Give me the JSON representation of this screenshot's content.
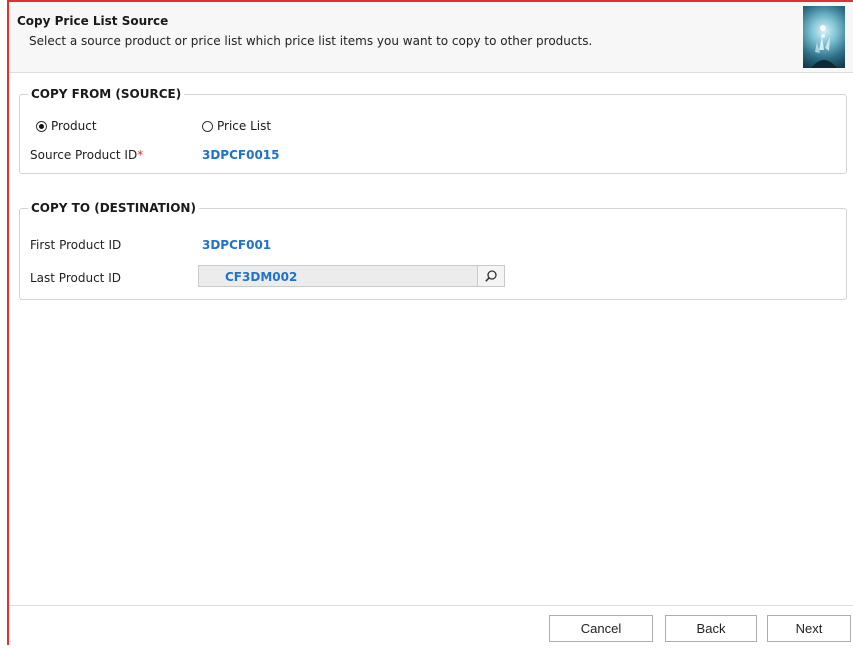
{
  "header": {
    "title": "Copy Price List Source",
    "subtitle": "Select a source product or price list which price list items you want to copy to other products."
  },
  "copy_from": {
    "title": "COPY FROM (SOURCE)",
    "options": [
      {
        "label": "Product",
        "selected": true
      },
      {
        "label": "Price List",
        "selected": false
      }
    ],
    "source_product_label": "Source Product ID",
    "required_mark": "*",
    "source_product_value": "3DPCF0015"
  },
  "copy_to": {
    "title": "COPY TO (DESTINATION)",
    "first_product_label": "First Product ID",
    "first_product_value": "3DPCF001",
    "last_product_label": "Last Product ID",
    "last_product_value": "CF3DM002"
  },
  "footer": {
    "cancel_label": "Cancel",
    "back_label": "Back",
    "next_label": "Next"
  },
  "icons": {
    "header_image": "wizard-graphic-icon",
    "lookup": "search-icon"
  },
  "colors": {
    "accent": "#1f73c9",
    "required": "#d23030",
    "window_border": "#e03030"
  }
}
